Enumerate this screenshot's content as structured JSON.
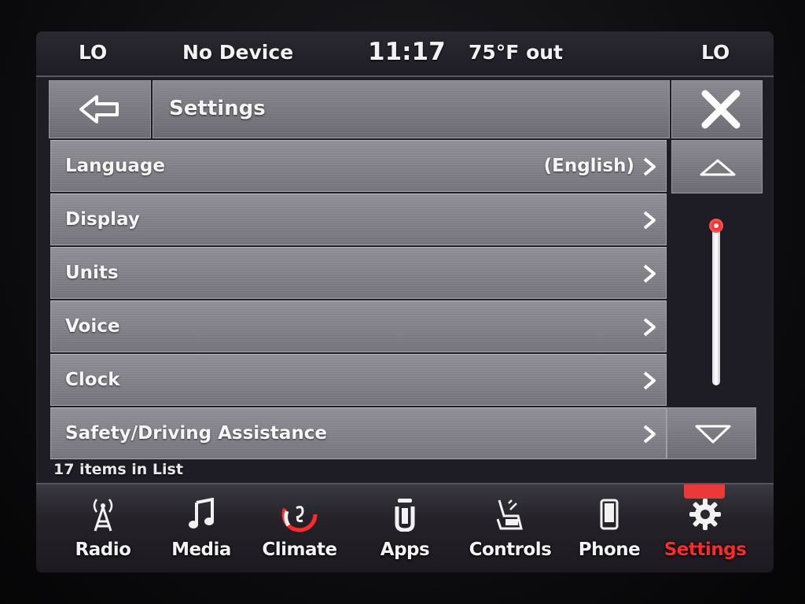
{
  "status": {
    "left_temp": "LO",
    "device": "No Device",
    "time": "11:17",
    "outside_temp": "75°F out",
    "right_temp": "LO"
  },
  "header": {
    "title": "Settings",
    "back_icon": "back-arrow-icon",
    "close_icon": "close-icon"
  },
  "list": {
    "items": [
      {
        "label": "Language",
        "value": "(English)"
      },
      {
        "label": "Display",
        "value": ""
      },
      {
        "label": "Units",
        "value": ""
      },
      {
        "label": "Voice",
        "value": ""
      },
      {
        "label": "Clock",
        "value": ""
      },
      {
        "label": "Safety/Driving Assistance",
        "value": ""
      }
    ],
    "count_text": "17 items in List"
  },
  "nav": {
    "items": [
      {
        "label": "Radio",
        "icon": "radio-tower-icon"
      },
      {
        "label": "Media",
        "icon": "music-note-icon"
      },
      {
        "label": "Climate",
        "icon": "climate-fan-icon"
      },
      {
        "label": "Apps",
        "icon": "apps-icon"
      },
      {
        "label": "Controls",
        "icon": "controls-seat-icon"
      },
      {
        "label": "Phone",
        "icon": "phone-icon"
      },
      {
        "label": "Settings",
        "icon": "gear-icon"
      }
    ],
    "active": "Settings"
  },
  "colors": {
    "accent": "#ff2a2a",
    "tile": "#807e86",
    "text": "#f4f4f4"
  }
}
